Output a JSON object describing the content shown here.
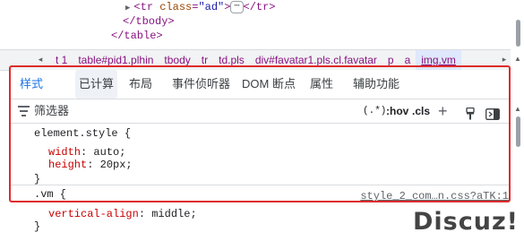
{
  "elements_tree": {
    "line1": {
      "open": "<",
      "tag": "tr",
      "attr_name": "class",
      "attr_value": "\"ad\"",
      "close": ">",
      "ellipsis": "⋯",
      "end_tag": "</tr>"
    },
    "line2": "</tbody>",
    "line3": "</table>"
  },
  "breadcrumb": {
    "left_arrow": "◂",
    "right_arrow": "▸",
    "items": [
      "t 1",
      "table#pid1.plhin",
      "tbody",
      "tr",
      "td.pls",
      "div#favatar1.pls.cl.favatar",
      "p",
      "a",
      "img.vm"
    ],
    "selected_index": 8
  },
  "tabs": [
    "样式",
    "已计算",
    "布局",
    "事件侦听器",
    "DOM 断点",
    "属性",
    "辅助功能"
  ],
  "active_tab": "样式",
  "filter": {
    "label": "筛选器",
    "hov": ":hov",
    "cls": ".cls",
    "toggle_format": "(.*)",
    "plus": "+"
  },
  "styles": {
    "element_style": {
      "selector": "element.style {",
      "props": [
        {
          "name": "width",
          "value": "auto;"
        },
        {
          "name": "height",
          "value": "20px;"
        }
      ],
      "close": "}"
    },
    "vm_rule": {
      "selector": ".vm {",
      "source": "style_2_com…n.css?aTK:1",
      "props": [
        {
          "name": "vertical-align",
          "value": "middle;"
        }
      ],
      "close": "}"
    }
  },
  "watermark": "Discuz!"
}
